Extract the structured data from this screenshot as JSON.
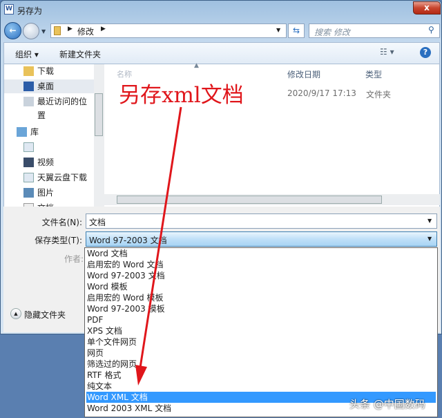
{
  "window": {
    "title": "另存为",
    "close": "x"
  },
  "address": {
    "path": "修改",
    "search_placeholder": "搜索 修改"
  },
  "toolbar": {
    "organize": "组织 ▾",
    "new_folder": "新建文件夹"
  },
  "nav": {
    "items": [
      {
        "label": "下载"
      },
      {
        "label": "桌面"
      },
      {
        "label": "最近访问的位置"
      },
      {
        "label": "库"
      },
      {
        "label": ""
      },
      {
        "label": "视频"
      },
      {
        "label": "天翼云盘下载"
      },
      {
        "label": "图片"
      },
      {
        "label": "文档"
      }
    ]
  },
  "content": {
    "columns": [
      "名称",
      "修改日期",
      "类型"
    ],
    "rows": [
      {
        "date": "2020/9/17 17:13",
        "type": "文件夹"
      }
    ]
  },
  "form": {
    "filename_label": "文件名(N):",
    "filename_value": "文档",
    "type_label": "保存类型(T):",
    "type_value": "Word 97-2003 文档",
    "author_label": "作者:",
    "hide_folders": "隐藏文件夹"
  },
  "dropdown": {
    "options": [
      "Word 文档",
      "启用宏的 Word 文档",
      "Word 97-2003 文档",
      "Word 模板",
      "启用宏的 Word 模板",
      "Word 97-2003 模板",
      "PDF",
      "XPS 文档",
      "单个文件网页",
      "网页",
      "筛选过的网页",
      "RTF 格式",
      "纯文本",
      "Word XML 文档",
      "Word 2003 XML 文档"
    ],
    "selected_index": 13
  },
  "annotation": {
    "text": "另存xml文档",
    "color": "#e0161b"
  },
  "watermark": "头条 @中国数码"
}
